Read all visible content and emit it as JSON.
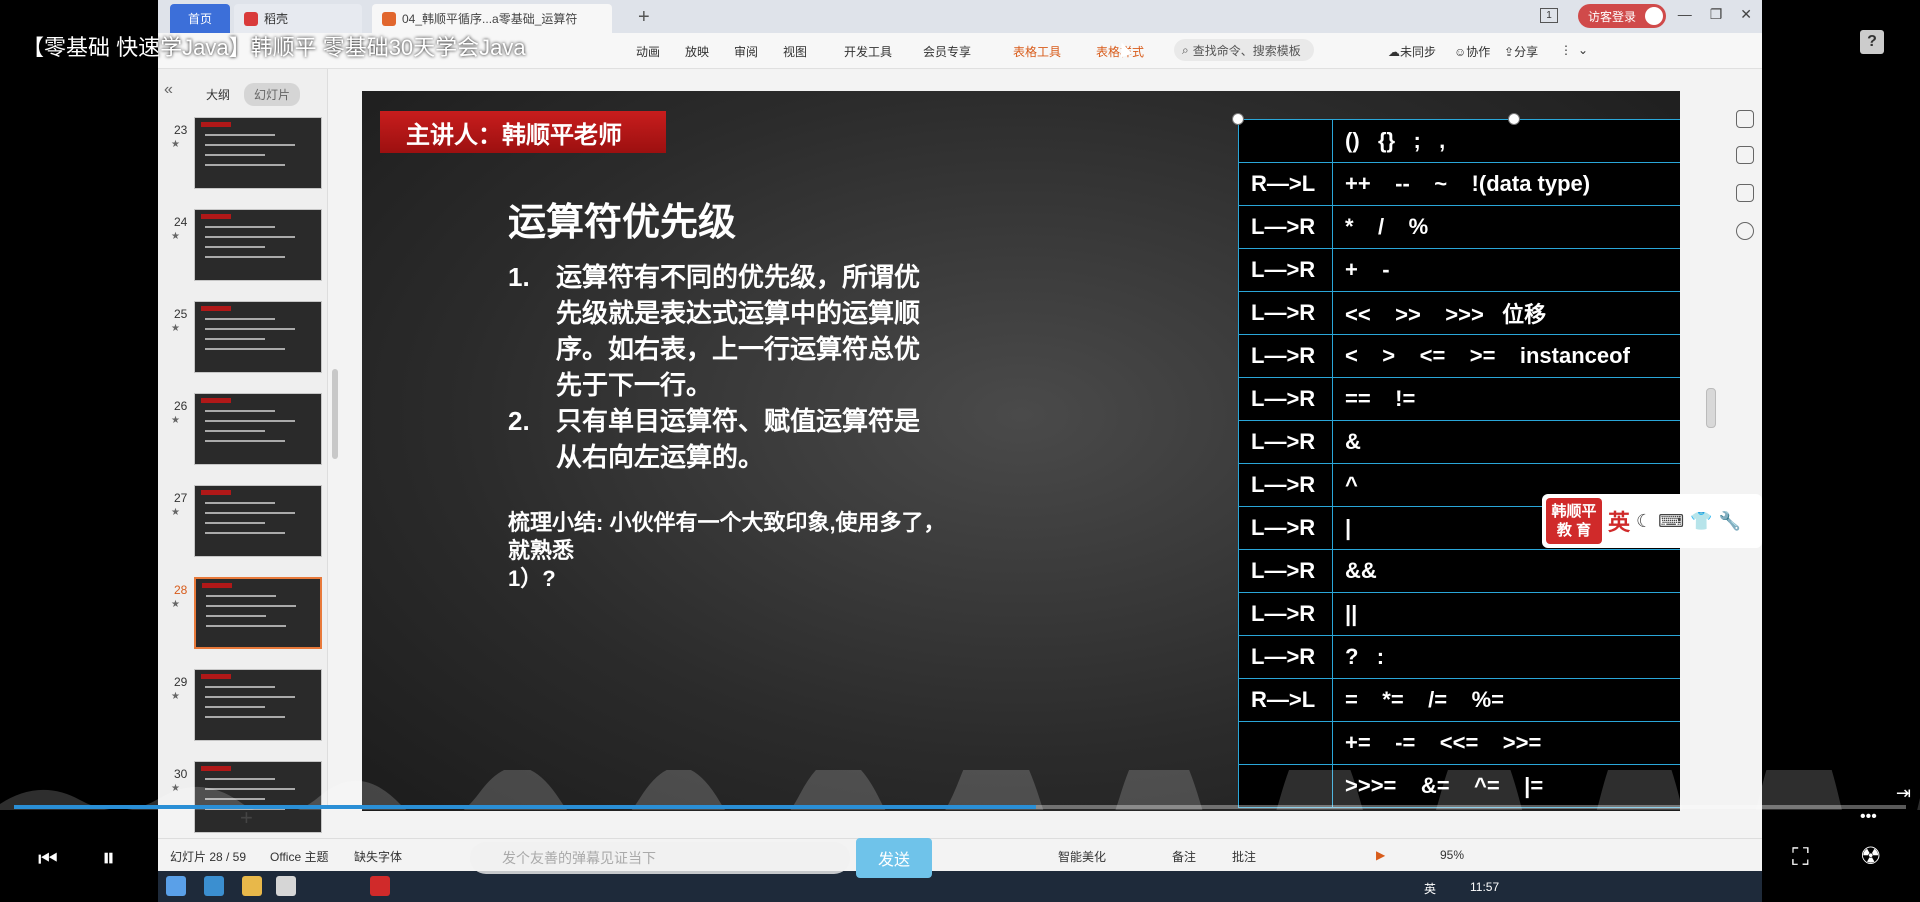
{
  "video": {
    "title": "【零基础 快速学Java】韩顺平 零基础30天学会Java",
    "progress_fraction": 0.54
  },
  "tabs": {
    "home": "首页",
    "draft": "稻壳",
    "doc": "04_韩顺平循序...a零基础_运算符",
    "counter": "1",
    "login": "访客登录"
  },
  "ribbon": {
    "items": [
      "动画",
      "放映",
      "审阅",
      "视图",
      "开发工具",
      "会员专享"
    ],
    "orange_items": [
      "表格工具",
      "表格样式"
    ],
    "search": "查找命令、搜索模板",
    "sync": "未同步",
    "collab": "协作",
    "share": "分享"
  },
  "side": {
    "outline": "大纲",
    "slides": "幻灯片",
    "thumbnails": [
      {
        "num": "23"
      },
      {
        "num": "24"
      },
      {
        "num": "25"
      },
      {
        "num": "26"
      },
      {
        "num": "27"
      },
      {
        "num": "28",
        "active": true
      },
      {
        "num": "29"
      },
      {
        "num": "30"
      }
    ]
  },
  "slide": {
    "speaker": "主讲人：韩顺平老师",
    "title": "运算符优先级",
    "points": [
      {
        "num": "1.",
        "text": "运算符有不同的优先级，所谓优先级就是表达式运算中的运算顺序。如右表，上一行运算符总优先于下一行。"
      },
      {
        "num": "2.",
        "text": "只有单目运算符、赋值运算符是从右向左运算的。"
      }
    ],
    "summary": "梳理小结: 小伙伴有一个大致印象,使用多了，就熟悉",
    "summary_item": "1）?",
    "table": [
      {
        "dir": "",
        "ops": "()   {}   ;   ,"
      },
      {
        "dir": "R—>L",
        "ops": "++    --    ~    !(data type)"
      },
      {
        "dir": "L—>R",
        "ops": "*    /    %"
      },
      {
        "dir": "L—>R",
        "ops": "+    -"
      },
      {
        "dir": "L—>R",
        "ops": "<<    >>    >>>   位移"
      },
      {
        "dir": "L—>R",
        "ops": "<    >    <=    >=    instanceof"
      },
      {
        "dir": "L—>R",
        "ops": "==    !="
      },
      {
        "dir": "L—>R",
        "ops": "&"
      },
      {
        "dir": "L—>R",
        "ops": "^"
      },
      {
        "dir": "L—>R",
        "ops": "|"
      },
      {
        "dir": "L—>R",
        "ops": "&&"
      },
      {
        "dir": "L—>R",
        "ops": "||"
      },
      {
        "dir": "L—>R",
        "ops": "?   :"
      },
      {
        "dir": "R—>L",
        "ops": "=    *=    /=    %="
      },
      {
        "dir": "",
        "ops": "+=    -=    <<=    >>="
      },
      {
        "dir": "",
        "ops": ">>>=    &=    ^=    |="
      }
    ]
  },
  "logo": {
    "line1": "韩顺平",
    "line2": "教 育",
    "lang": "英"
  },
  "status": {
    "slide_count": "幻灯片 28 / 59",
    "theme": "Office 主题",
    "missing_font": "缺失字体",
    "beautify": "智能美化",
    "notes": "备注",
    "comments": "批注",
    "zoom": "95%",
    "send": "发送",
    "chat_placeholder": "发个友善的弹幕见证当下"
  },
  "taskbar": {
    "ime": "英",
    "time": "11:57"
  }
}
